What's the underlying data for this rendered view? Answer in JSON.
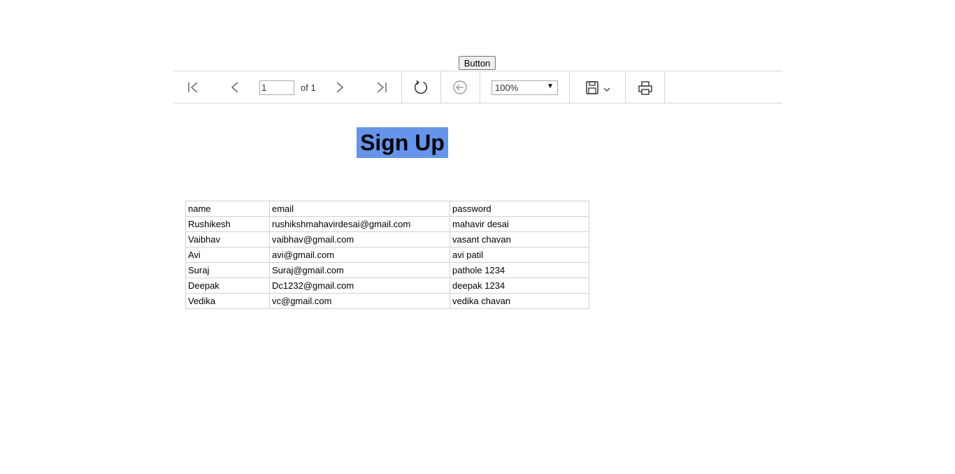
{
  "top_button": {
    "label": "Button"
  },
  "toolbar": {
    "first_page_icon": "first-page-icon",
    "prev_page_icon": "previous-page-icon",
    "page_number": "1",
    "page_of": "of 1",
    "next_page_icon": "next-page-icon",
    "last_page_icon": "last-page-icon",
    "refresh_icon": "refresh-icon",
    "back_icon": "back-icon",
    "zoom": "100%",
    "save_icon": "save-icon",
    "print_icon": "print-icon"
  },
  "heading": "Sign Up",
  "table": {
    "header": [
      "name",
      "email",
      "password"
    ],
    "rows": [
      [
        "Rushikesh",
        "rushikshmahavirdesai@gmail.com",
        "mahavir desai"
      ],
      [
        "Vaibhav",
        "vaibhav@gmail.com",
        "vasant chavan"
      ],
      [
        "Avi",
        "avi@gmail.com",
        "avi patil"
      ],
      [
        "Suraj",
        "Suraj@gmail.com",
        "pathole 1234"
      ],
      [
        "Deepak",
        "Dc1232@gmail.com",
        "deepak 1234"
      ],
      [
        "Vedika",
        "vc@gmail.com",
        "vedika chavan"
      ]
    ]
  },
  "colors": {
    "heading_bg": "#6495ed",
    "border": "#d6d6d6"
  }
}
